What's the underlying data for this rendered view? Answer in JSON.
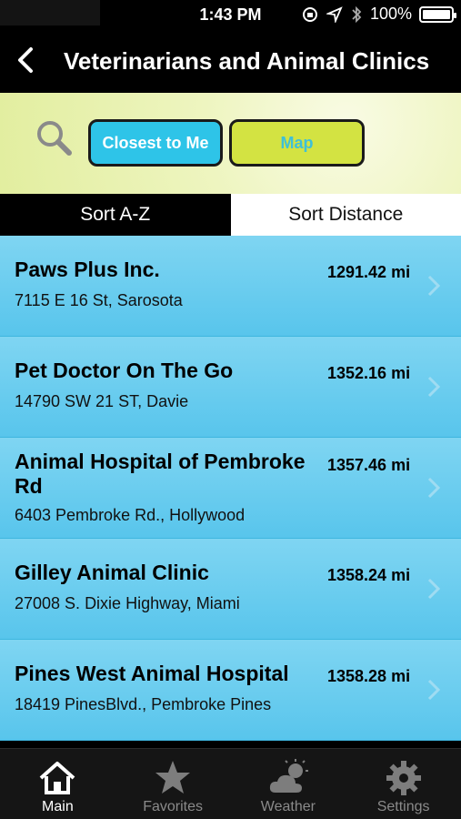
{
  "status_bar": {
    "time": "1:43 PM",
    "battery": "100%",
    "battery_level": 1.0
  },
  "nav": {
    "title": "Veterinarians and Animal Clinics",
    "back_icon": "chevron-left-icon"
  },
  "filters": {
    "closest_label": "Closest to Me",
    "map_label": "Map",
    "search_icon": "search-icon"
  },
  "sort": {
    "az_label": "Sort A-Z",
    "distance_label": "Sort Distance",
    "active": "az"
  },
  "clinics": [
    {
      "name": "Paws Plus Inc.",
      "address": "7115 E 16 St, Sarosota",
      "distance": "1291.42 mi"
    },
    {
      "name": "Pet Doctor On The Go",
      "address": "14790 SW 21 ST, Davie",
      "distance": "1352.16 mi"
    },
    {
      "name": "Animal Hospital of Pembroke Rd",
      "address": "6403 Pembroke Rd., Hollywood",
      "distance": "1357.46 mi"
    },
    {
      "name": "Gilley Animal Clinic",
      "address": "27008 S. Dixie Highway, Miami",
      "distance": "1358.24 mi"
    },
    {
      "name": "Pines West Animal Hospital",
      "address": "18419 PinesBlvd., Pembroke Pines",
      "distance": "1358.28 mi"
    }
  ],
  "tabs": [
    {
      "label": "Main",
      "icon": "home-icon",
      "active": true
    },
    {
      "label": "Favorites",
      "icon": "star-icon",
      "active": false
    },
    {
      "label": "Weather",
      "icon": "cloud-sun-icon",
      "active": false
    },
    {
      "label": "Settings",
      "icon": "gear-icon",
      "active": false
    }
  ],
  "colors": {
    "row": "#58c5ec",
    "closest_button": "#2ec4e8",
    "map_button": "#d3e342",
    "tab_bar": "#151515"
  }
}
